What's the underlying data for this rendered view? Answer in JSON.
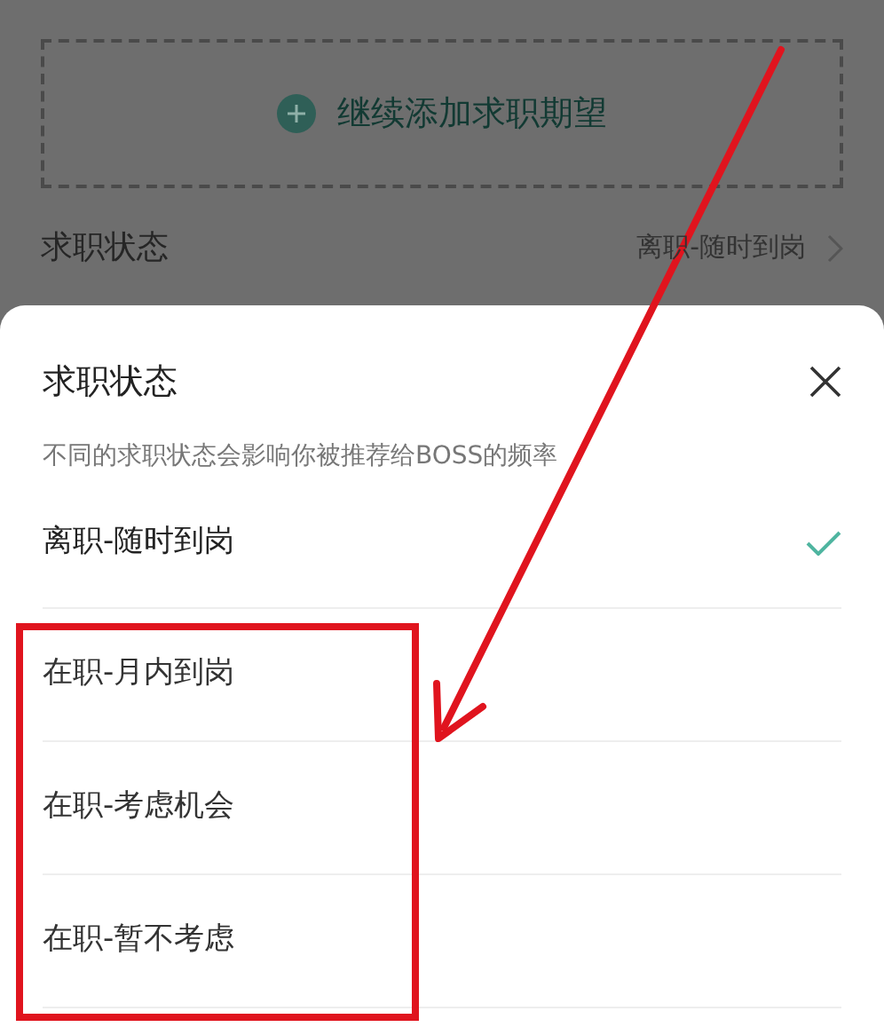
{
  "background": {
    "add_button": {
      "label": "继续添加求职期望"
    },
    "status_row": {
      "label": "求职状态",
      "value": "离职-随时到岗"
    }
  },
  "sheet": {
    "title": "求职状态",
    "subtitle": "不同的求职状态会影响你被推荐给BOSS的频率",
    "options": [
      {
        "label": "离职-随时到岗",
        "selected": true
      },
      {
        "label": "在职-月内到岗",
        "selected": false
      },
      {
        "label": "在职-考虑机会",
        "selected": false
      },
      {
        "label": "在职-暂不考虑",
        "selected": false
      }
    ]
  },
  "annotations": {
    "arrow": true,
    "frame": true
  }
}
